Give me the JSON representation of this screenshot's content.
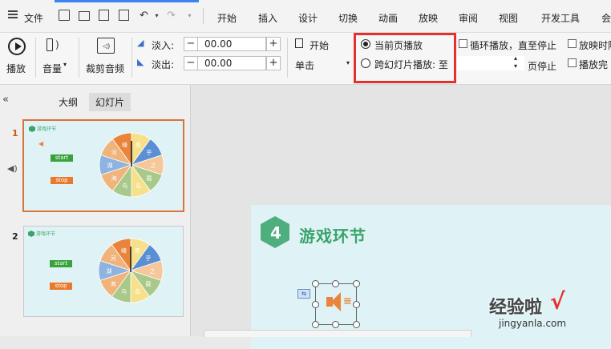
{
  "menu": {
    "file": "文件",
    "tabs": [
      "开始",
      "插入",
      "设计",
      "切换",
      "动画",
      "放映",
      "审阅",
      "视图",
      "开发工具",
      "会"
    ]
  },
  "ribbon": {
    "play": "播放",
    "volume": "音量",
    "trim": "裁剪音频",
    "fade_in_label": "淡入:",
    "fade_out_label": "淡出:",
    "fade_in_value": "00.00",
    "fade_out_value": "00.00",
    "start_label": "开始",
    "start_value": "单击",
    "radio_current": "当前页播放",
    "radio_cross": "跨幻灯片播放: 至",
    "page_stop": "页停止",
    "loop": "循环播放，直至停止",
    "hide_play": "放映时隐",
    "rewind": "播放完"
  },
  "left_pane": {
    "tab_outline": "大纲",
    "tab_slides": "幻灯片",
    "slides": [
      {
        "number": "1"
      },
      {
        "number": "2"
      }
    ],
    "thumb_title": "游戏环节",
    "start_btn": "start",
    "stop_btn": "stop"
  },
  "wheel": {
    "chars": [
      "原",
      "乎",
      "之",
      "载",
      "岛",
      "鸟",
      "海",
      "湖",
      "河",
      "峰"
    ],
    "colors": [
      "#f7e08a",
      "#5b8fd4",
      "#f6c79a",
      "#a8c98a",
      "#f7e08a",
      "#a8c98a",
      "#f0b37a",
      "#8fb3e0",
      "#f0b37a",
      "#e9843a"
    ]
  },
  "main_slide": {
    "number": "4",
    "title": "游戏环节"
  },
  "watermark": {
    "text_cn": "经验啦",
    "check": "√",
    "url": "jingyanla.com"
  },
  "highlight_color": "#e53030"
}
